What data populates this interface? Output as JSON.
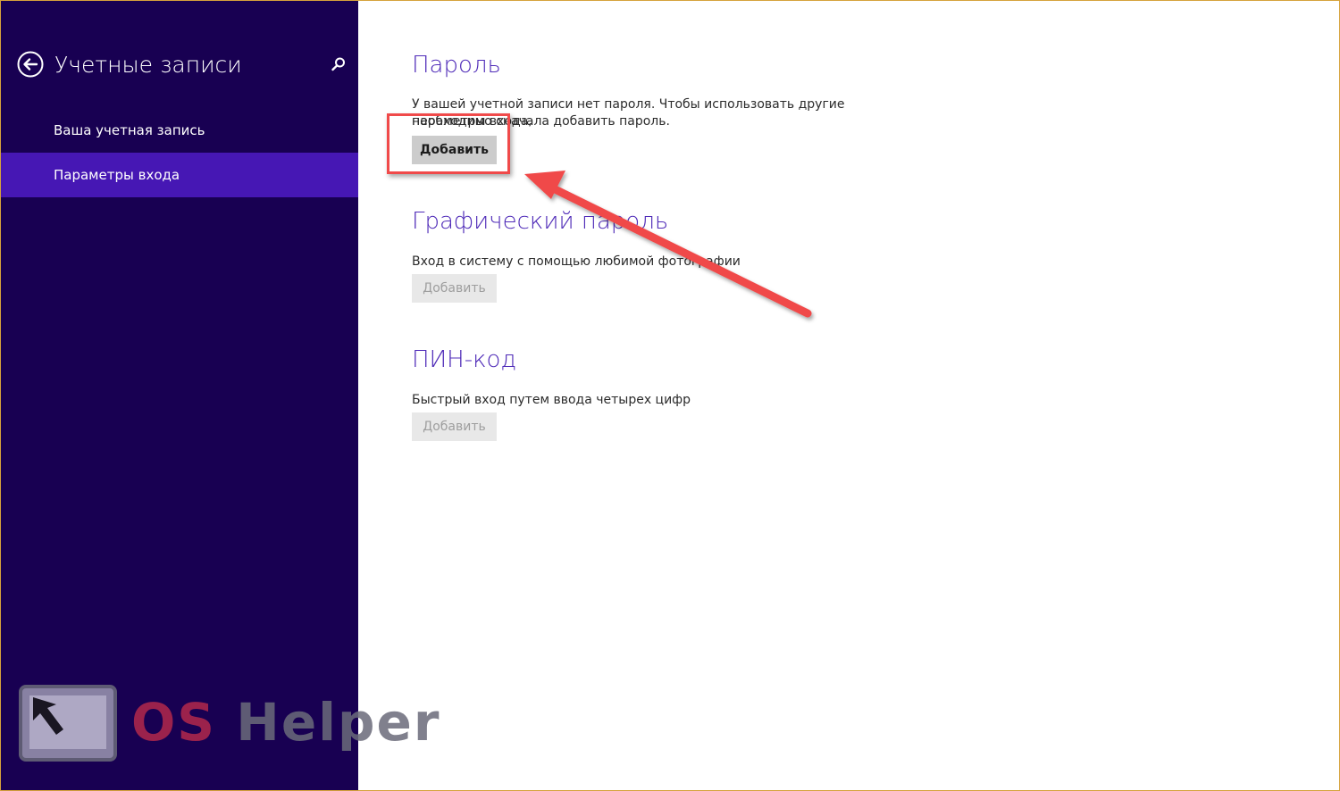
{
  "sidebar": {
    "title": "Учетные записи",
    "items": [
      {
        "label": "Ваша учетная запись",
        "active": false
      },
      {
        "label": "Параметры входа",
        "active": true
      }
    ]
  },
  "sections": {
    "password": {
      "heading": "Пароль",
      "description_line1": "У вашей учетной записи нет пароля. Чтобы использовать другие параметры входа,",
      "description_line2": "необходимо сначала добавить пароль.",
      "button_label": "Добавить"
    },
    "picture": {
      "heading": "Графический пароль",
      "description": "Вход в систему с помощью любимой фотографии",
      "button_label": "Добавить"
    },
    "pin": {
      "heading": "ПИН-код",
      "description": "Быстрый вход путем ввода четырех цифр",
      "button_label": "Добавить"
    }
  },
  "watermark": {
    "part1": "OS",
    "part2": "Helper"
  },
  "colors": {
    "sidebar_bg": "#180052",
    "active_item": "#4617b4",
    "heading": "#4f2bb8",
    "annotation": "#f04a4a"
  }
}
